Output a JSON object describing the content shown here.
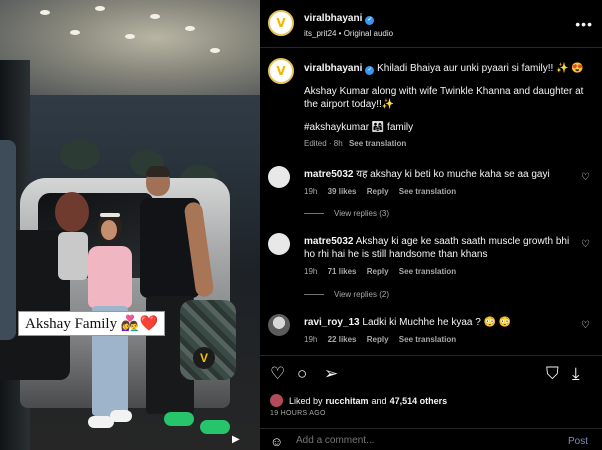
{
  "media": {
    "caption_overlay": "Akshay Family 👩‍❤️‍👨❤️",
    "watermark_letter": "V",
    "sound_icon": "speaker-icon"
  },
  "header": {
    "username": "viralbhayani",
    "subtitle": "its_prit24 • Original audio",
    "more_icon": "•••"
  },
  "post": {
    "username": "viralbhayani",
    "caption_line1": "Khiladi Bhaiya aur unki pyaari si family!! ✨ 😍",
    "caption_line2": "Akshay Kumar along with wife Twinkle Khanna and daughter at the airport today!!✨",
    "caption_line3": "#akshaykumar 👨‍👩‍👧 family",
    "edited": "Edited · 8h",
    "see_translation": "See translation"
  },
  "comments": [
    {
      "username": "matre5032",
      "text": "यह akshay ki beti ko muche kaha se aa gayi",
      "time": "19h",
      "likes": "39 likes",
      "reply": "Reply",
      "translate": "See translation",
      "view_replies": "View replies (3)"
    },
    {
      "username": "matre5032",
      "text": "Akshay ki age ke saath saath muscle growth bhi ho rhi hai he is still handsome than khans",
      "time": "19h",
      "likes": "71 likes",
      "reply": "Reply",
      "translate": "See translation",
      "view_replies": "View replies (2)"
    },
    {
      "username": "ravi_roy_13",
      "text": "Ladki ki Muchhe he kyaa ? 😳 😳",
      "time": "19h",
      "likes": "22 likes",
      "reply": "Reply",
      "translate": "See translation"
    }
  ],
  "actions": {
    "like_icon": "♡",
    "comment_icon": "○",
    "share_icon": "➢",
    "save_icon": "⛉",
    "download_icon": "⤓",
    "liked_prefix": "Liked by",
    "liked_user": "rucchitam",
    "liked_and": "and",
    "liked_others": "47,514 others",
    "time_ago": "19 HOURS AGO"
  },
  "add_comment": {
    "placeholder": "Add a comment...",
    "post_label": "Post",
    "emoji_icon": "☺"
  }
}
